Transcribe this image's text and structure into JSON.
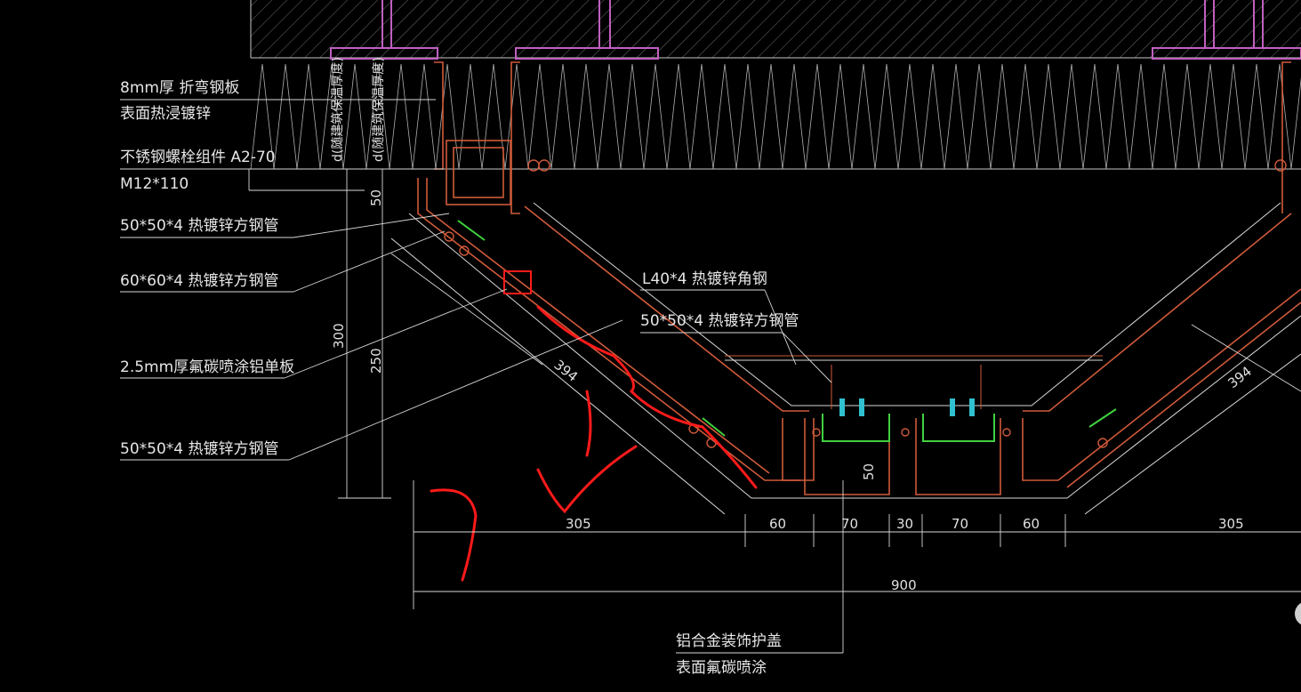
{
  "labels": {
    "bent_plate": "8mm厚 折弯钢板",
    "hot_dip": "表面热浸镀锌",
    "bolt_set": "不锈钢螺栓组件 A2-70",
    "bolt_size": "M12*110",
    "tube_50_a": "50*50*4 热镀锌方钢管",
    "tube_60": "60*60*4 热镀锌方钢管",
    "al_panel": "2.5mm厚氟碳喷涂铝单板",
    "tube_50_b": "50*50*4 热镀锌方钢管",
    "angle_l40": "L40*4 热镀锌角钢",
    "tube_50_c": "50*50*4 热镀锌方钢管",
    "cover_1": "铝合金装饰护盖",
    "cover_2": "表面氟碳喷涂"
  },
  "vertical_labels": {
    "left": "d(随建筑保温厚度)",
    "right": "d(随建筑保温厚度)"
  },
  "dimensions": {
    "d50_left": "50",
    "d300": "300",
    "d250": "250",
    "slope_left": "394",
    "slope_right": "394",
    "d305_left": "305",
    "d60_a": "60",
    "d70_a": "70",
    "d30": "30",
    "d70_b": "70",
    "d60_b": "60",
    "d305_right": "305",
    "d900": "900",
    "d50_mid": "50"
  },
  "colors": {
    "background": "#000000",
    "line": "#d8d8d8",
    "steel": "#d05a3a",
    "purple": "#c060c0",
    "green": "#40d040",
    "cyan": "#30c0d0",
    "markup": "#ff1a1a"
  }
}
